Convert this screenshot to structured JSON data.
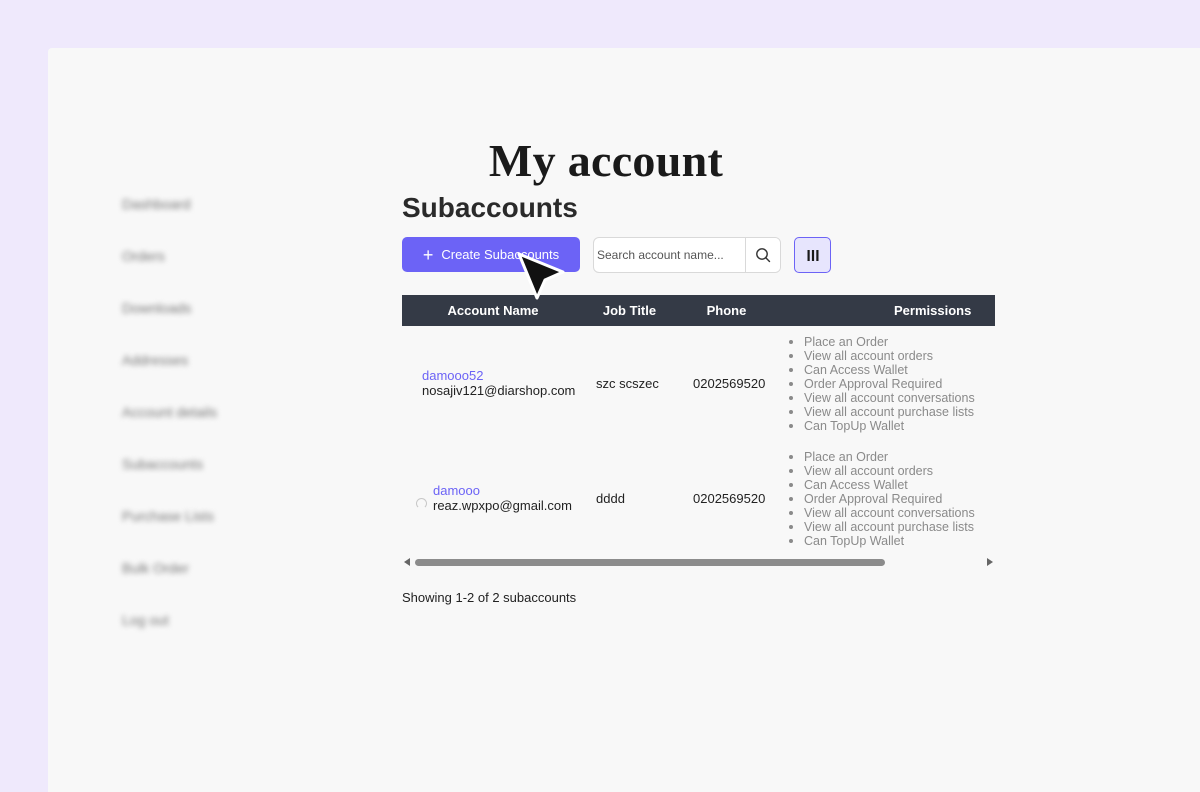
{
  "page": {
    "title": "My account"
  },
  "sidebar": {
    "items": [
      {
        "label": "Dashboard"
      },
      {
        "label": "Orders"
      },
      {
        "label": "Downloads"
      },
      {
        "label": "Addresses"
      },
      {
        "label": "Account details"
      },
      {
        "label": "Subaccounts"
      },
      {
        "label": "Purchase Lists"
      },
      {
        "label": "Bulk Order"
      },
      {
        "label": "Log out"
      }
    ]
  },
  "main": {
    "section_title": "Subaccounts",
    "create_button_label": "Create Subaccounts",
    "search": {
      "placeholder": "Search account name...",
      "value": ""
    },
    "table": {
      "headers": {
        "account_name": "Account Name",
        "job_title": "Job Title",
        "phone": "Phone",
        "permissions": "Permissions"
      },
      "rows": [
        {
          "account_name": "damooo52",
          "email": "nosajiv121@diarshop.com",
          "job_title": "szc scszec",
          "phone": "0202569520",
          "permissions": [
            "Place an Order",
            "View all account orders",
            "Can Access Wallet",
            "Order Approval Required",
            "View all account conversations",
            "View all account purchase lists",
            "Can TopUp Wallet"
          ]
        },
        {
          "account_name": "damooo",
          "email": "reaz.wpxpo@gmail.com",
          "job_title": "dddd",
          "phone": "0202569520",
          "permissions": [
            "Place an Order",
            "View all account orders",
            "Can Access Wallet",
            "Order Approval Required",
            "View all account conversations",
            "View all account purchase lists",
            "Can TopUp Wallet"
          ]
        }
      ]
    },
    "horizontal_scroll_fraction": 0.83,
    "footer_text": "Showing 1-2 of 2 subaccounts"
  },
  "icons": {
    "create": "plus-icon",
    "search": "search-icon",
    "columns": "columns-icon",
    "loading": "spinner-icon",
    "pointer": "cursor-icon"
  },
  "colors": {
    "accent": "#6c63f6",
    "header_bg": "#343a46",
    "outer_bg": "#efe9fc",
    "page_bg": "#f8f8f8"
  }
}
